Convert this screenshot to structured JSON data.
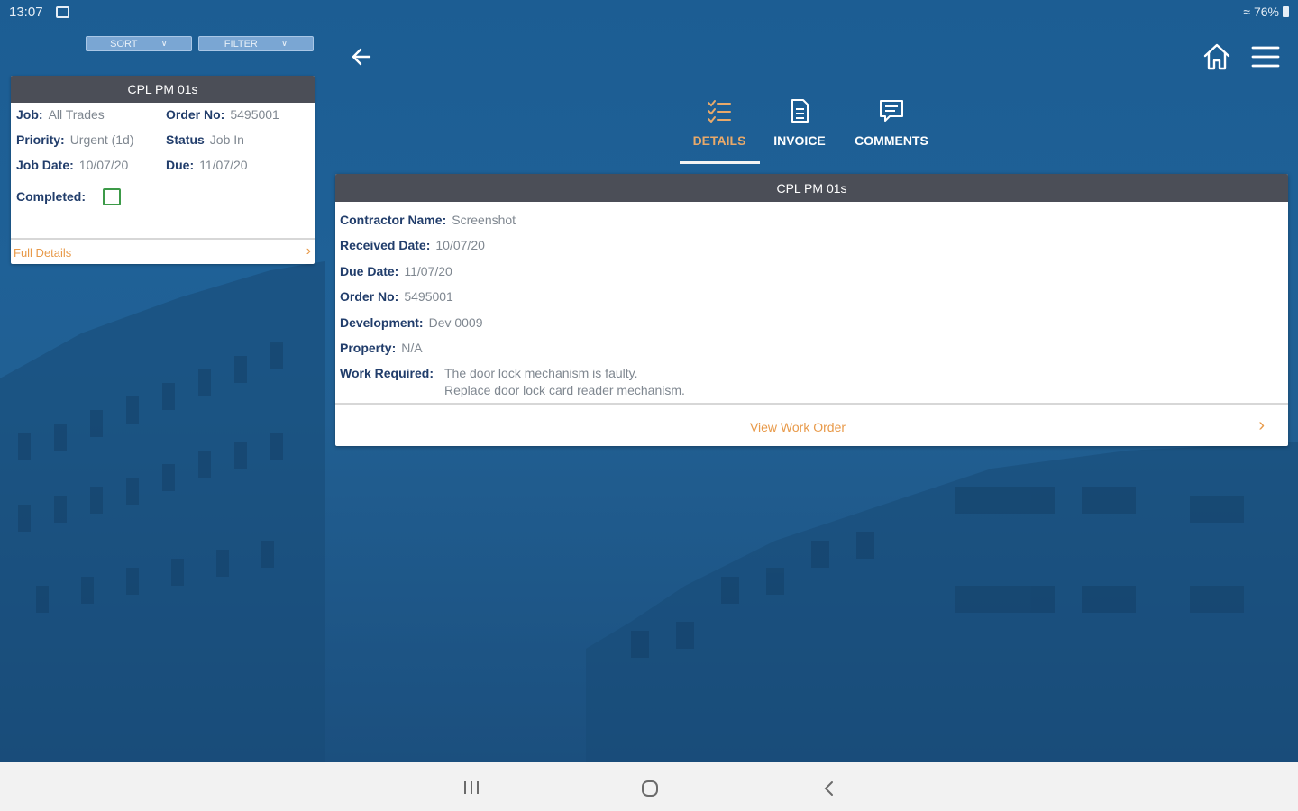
{
  "status_bar": {
    "time": "13:07",
    "battery": "76%",
    "icons": [
      "image-icon",
      "wifi-icon",
      "battery-icon"
    ]
  },
  "list_controls": {
    "sort_label": "SORT",
    "filter_label": "FILTER"
  },
  "list_card": {
    "title": "CPL PM 01s",
    "job_label": "Job:",
    "job_value": "All Trades",
    "order_label": "Order No:",
    "order_value": "5495001",
    "priority_label": "Priority:",
    "priority_value": "Urgent (1d)",
    "status_label": "Status",
    "status_value": "Job In",
    "job_date_label": "Job Date:",
    "job_date_value": "10/07/20",
    "due_label": "Due:",
    "due_value": "11/07/20",
    "completed_label": "Completed:",
    "completed_checked": false,
    "full_details_label": "Full Details"
  },
  "header": {
    "icons": [
      "back-arrow-icon",
      "home-icon",
      "menu-icon"
    ]
  },
  "tabs": [
    {
      "label": "DETAILS",
      "icon": "checklist-icon",
      "active": true
    },
    {
      "label": "INVOICE",
      "icon": "document-icon",
      "active": false
    },
    {
      "label": "COMMENTS",
      "icon": "comment-icon",
      "active": false
    }
  ],
  "detail_card": {
    "title": "CPL PM 01s",
    "fields": [
      {
        "label": "Contractor Name:",
        "value": "Screenshot"
      },
      {
        "label": "Received Date:",
        "value": "10/07/20"
      },
      {
        "label": "Due Date:",
        "value": "11/07/20"
      },
      {
        "label": "Order No:",
        "value": "5495001"
      },
      {
        "label": "Development:",
        "value": "Dev 0009"
      },
      {
        "label": "Property:",
        "value": "N/A"
      }
    ],
    "work_required_label": "Work Required:",
    "work_required_line1": "The door lock mechanism is faulty.",
    "work_required_line2": "Replace door lock card reader mechanism.",
    "view_work_order_label": "View Work Order"
  },
  "colors": {
    "accent": "#e89a4a",
    "header_bar": "#4b4e57",
    "label": "#213d6b",
    "checkbox": "#3c9a48",
    "background": "#1f5f92"
  }
}
